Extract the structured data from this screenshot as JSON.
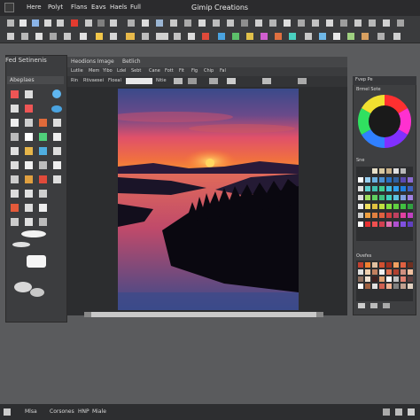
{
  "app": {
    "title": "Gimip Creations",
    "menu": [
      "Here",
      "Polyt",
      "Flans",
      "Eavs",
      "Haels",
      "Full"
    ]
  },
  "left_panel": {
    "header": "Fed Setinenis",
    "tool_options_label": "Abeplaes"
  },
  "document": {
    "tabs": [
      "Heodions Image",
      "Betlich"
    ],
    "menu": [
      "Lutlie",
      "Mem",
      "Ylbo",
      "Ldel",
      "Sebt",
      "Cane",
      "Fott",
      "Fit",
      "Fig",
      "Chip",
      "Fal"
    ],
    "options": [
      "Rin",
      "Rtivaesei",
      "Floeal",
      "Nitie"
    ]
  },
  "right_panel": {
    "tab_labels": [
      "Fvep Pe"
    ],
    "color_panel_label": "Brmel Sote",
    "swatch_panel_label": "Sne",
    "palette_label": "Ovefes"
  },
  "statusbar": {
    "items": [
      "Mlsa",
      "Corsones",
      "HNP",
      "Miale"
    ]
  },
  "colors": {
    "accent": "#d0651f",
    "bg_dark": "#2b2b2d",
    "panel": "#3c3d3f"
  }
}
